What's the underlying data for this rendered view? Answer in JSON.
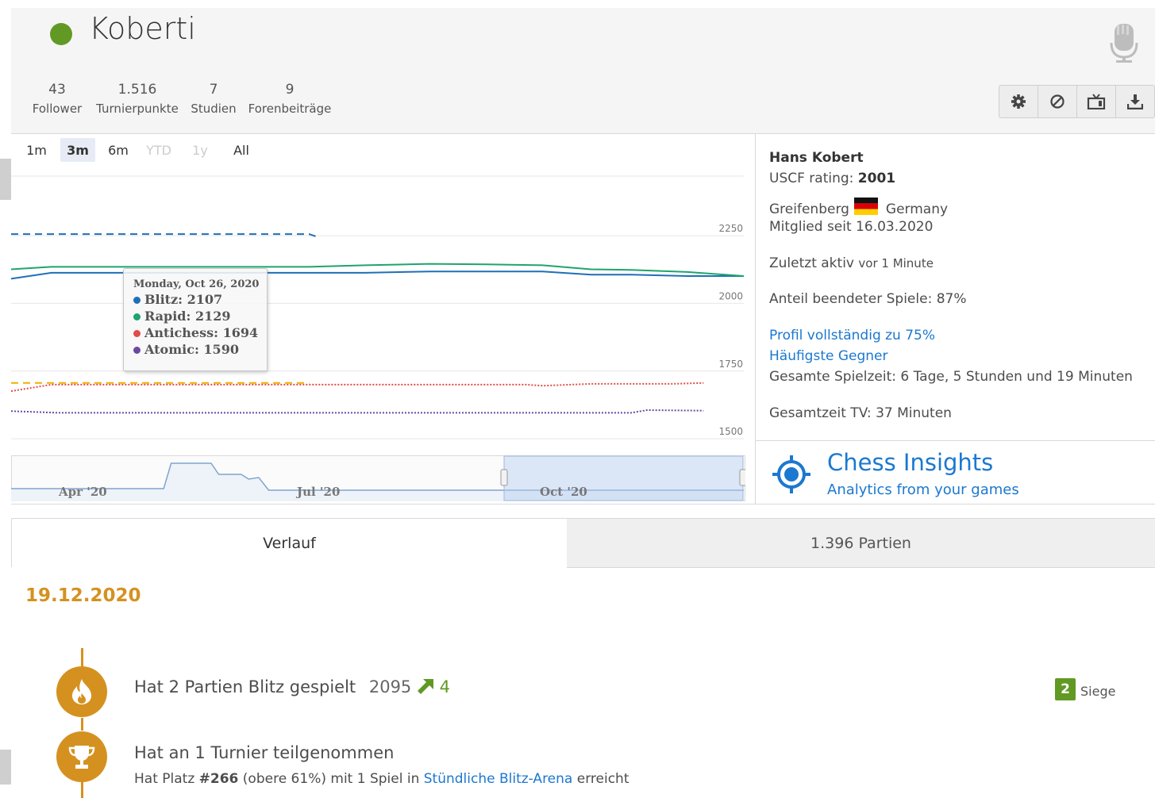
{
  "header": {
    "username": "Koberti",
    "status_color": "#629924",
    "stats": [
      {
        "value": "43",
        "label": "Follower"
      },
      {
        "value": "1.516",
        "label": "Turnierpunkte"
      },
      {
        "value": "7",
        "label": "Studien"
      },
      {
        "value": "9",
        "label": "Forenbeiträge"
      }
    ],
    "icons": [
      "microphone-icon",
      "gear-icon",
      "block-icon",
      "tv-icon",
      "download-icon"
    ]
  },
  "chart": {
    "range_buttons": [
      "1m",
      "3m",
      "6m",
      "YTD",
      "1y",
      "All"
    ],
    "active_range": "3m",
    "disabled_ranges": [
      "YTD",
      "1y"
    ],
    "navigator_labels": [
      "Apr '20",
      "Jul '20",
      "Oct '20"
    ],
    "tooltip": {
      "date": "Monday, Oct 26, 2020",
      "rows": [
        {
          "label": "Blitz: 2107",
          "color": "#1f6fb8"
        },
        {
          "label": "Rapid: 2129",
          "color": "#20a36e"
        },
        {
          "label": "Antichess: 1694",
          "color": "#e34a4a"
        },
        {
          "label": "Atomic: 1590",
          "color": "#6a4aa0"
        }
      ]
    }
  },
  "chart_data": {
    "type": "line",
    "title": "",
    "y_ticks": [
      1500,
      1750,
      2000,
      2250
    ],
    "ylim": [
      1430,
      2470
    ],
    "x_range": [
      "2020-09-19",
      "2020-12-19"
    ],
    "tooltip_date": "2020-10-26",
    "series": [
      {
        "name": "Blitz",
        "color": "#1f6fb8",
        "style": "solid",
        "x": [
          "2020-09-19",
          "2020-09-24",
          "2020-10-06",
          "2020-10-20",
          "2020-11-02",
          "2020-11-10",
          "2020-11-17",
          "2020-11-24",
          "2020-11-30",
          "2020-12-05",
          "2020-12-12",
          "2020-12-19"
        ],
        "values": [
          2085,
          2107,
          2107,
          2107,
          2107,
          2112,
          2112,
          2112,
          2100,
          2100,
          2095,
          2095
        ]
      },
      {
        "name": "Rapid",
        "color": "#20a36e",
        "style": "solid",
        "x": [
          "2020-09-19",
          "2020-09-24",
          "2020-10-06",
          "2020-10-26",
          "2020-11-02",
          "2020-11-10",
          "2020-11-17",
          "2020-11-24",
          "2020-11-30",
          "2020-12-05",
          "2020-12-12",
          "2020-12-19"
        ],
        "values": [
          2120,
          2129,
          2129,
          2129,
          2135,
          2140,
          2138,
          2135,
          2120,
          2118,
          2110,
          2095
        ]
      },
      {
        "name": "Classical",
        "color": "#1f6fb8",
        "style": "dashed",
        "x": [
          "2020-09-19",
          "2020-10-26",
          "2020-10-27"
        ],
        "values": [
          2250,
          2250,
          2240
        ]
      },
      {
        "name": "Chess960",
        "color": "#f0b000",
        "style": "dashed",
        "x": [
          "2020-09-19",
          "2020-10-26"
        ],
        "values": [
          1700,
          1700
        ]
      },
      {
        "name": "Antichess",
        "color": "#e34a4a",
        "style": "dotted",
        "x": [
          "2020-09-19",
          "2020-09-24",
          "2020-10-26",
          "2020-11-22",
          "2020-11-24",
          "2020-11-30",
          "2020-12-10",
          "2020-12-14"
        ],
        "values": [
          1670,
          1694,
          1694,
          1694,
          1690,
          1697,
          1697,
          1700
        ]
      },
      {
        "name": "Atomic",
        "color": "#6a4aa0",
        "style": "dotted",
        "x": [
          "2020-09-19",
          "2020-09-25",
          "2020-10-26",
          "2020-12-05",
          "2020-12-07",
          "2020-12-14"
        ],
        "values": [
          1596,
          1590,
          1590,
          1590,
          1600,
          1598
        ]
      }
    ]
  },
  "navigator_series": {
    "x": [
      "2020-03-01",
      "2020-05-01",
      "2020-05-04",
      "2020-05-20",
      "2020-05-23",
      "2020-06-01",
      "2020-06-04",
      "2020-06-08",
      "2020-06-12",
      "2020-12-19"
    ],
    "values": [
      0.15,
      0.15,
      0.95,
      0.95,
      0.6,
      0.6,
      0.45,
      0.5,
      0.1,
      0.1
    ]
  },
  "info": {
    "name": "Hans Kobert",
    "uscf_label": "USCF rating:",
    "uscf_value": "2001",
    "location": "Greifenberg",
    "country": "Germany",
    "member_since": "Mitglied seit 16.03.2020",
    "last_active_label": "Zuletzt aktiv",
    "last_active_value": "vor 1 Minute",
    "completion": "Anteil beendeter Spiele: 87%",
    "profile_link": "Profil vollständig zu 75%",
    "opponents_link": "Häufigste Gegner",
    "playtime": "Gesamte Spielzeit: 6 Tage, 5 Stunden und 19 Minuten",
    "tv_time": "Gesamtzeit TV: 37 Minuten",
    "insights_title": "Chess Insights",
    "insights_sub": "Analytics from your games"
  },
  "tabs": [
    {
      "label": "Verlauf",
      "active": true
    },
    {
      "label": "1.396 Partien",
      "active": false
    }
  ],
  "timeline": {
    "date": "19.12.2020",
    "entries": [
      {
        "icon": "fire-icon",
        "text": "Hat 2 Partien Blitz gespielt",
        "rating": "2095",
        "change": "4",
        "badge_count": "2",
        "badge_label": "Siege"
      },
      {
        "icon": "trophy-icon",
        "text": "Hat an 1 Turnier teilgenommen",
        "detail_prefix": "Hat Platz ",
        "detail_rank": "#266",
        "detail_mid": " (obere 61%) mit 1 Spiel in ",
        "detail_link": "Stündliche Blitz-Arena",
        "detail_suffix": " erreicht"
      }
    ]
  },
  "colors": {
    "accent": "#d59120",
    "link": "#1b78d0",
    "green": "#629924"
  }
}
